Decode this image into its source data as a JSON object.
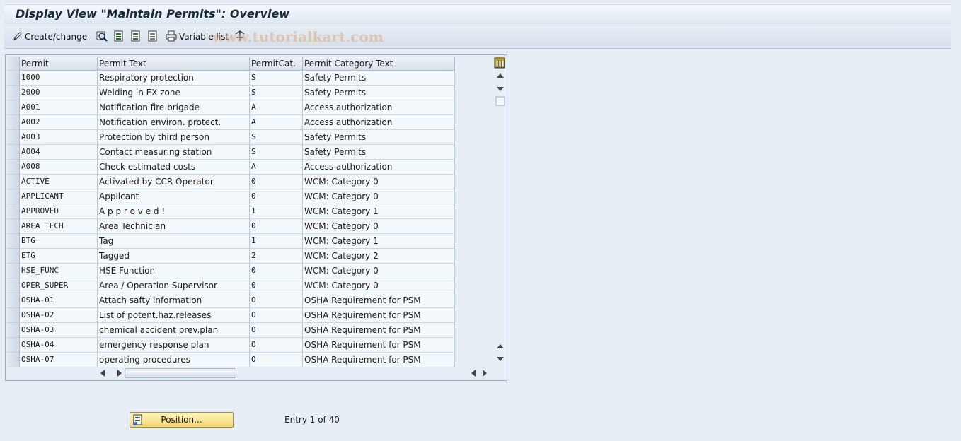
{
  "window": {
    "title": "Display View \"Maintain Permits\": Overview"
  },
  "toolbar": {
    "create_change_label": "Create/change",
    "variable_list_label": "Variable list",
    "watermark": "www.tutorialkart.com",
    "icons": [
      "pencil-icon",
      "search-icon",
      "select-all-icon",
      "select-block-icon",
      "deselect-all-icon",
      "printer-icon",
      "transport-icon"
    ]
  },
  "table": {
    "columns": [
      "Permit",
      "Permit Text",
      "PermitCat.",
      "Permit Category Text"
    ],
    "rows": [
      [
        "1000",
        "Respiratory protection",
        "S",
        "Safety Permits"
      ],
      [
        "2000",
        "Welding in EX zone",
        "S",
        "Safety Permits"
      ],
      [
        "A001",
        "Notification fire brigade",
        "A",
        "Access authorization"
      ],
      [
        "A002",
        "Notification environ. protect.",
        "A",
        "Access authorization"
      ],
      [
        "A003",
        "Protection by third person",
        "S",
        "Safety Permits"
      ],
      [
        "A004",
        "Contact measuring station",
        "S",
        "Safety Permits"
      ],
      [
        "A008",
        "Check estimated costs",
        "A",
        "Access authorization"
      ],
      [
        "ACTIVE",
        "Activated by CCR Operator",
        "0",
        "WCM: Category 0"
      ],
      [
        "APPLICANT",
        "Applicant",
        "0",
        "WCM: Category 0"
      ],
      [
        "APPROVED",
        "A p p r o v e d !",
        "1",
        "WCM: Category 1"
      ],
      [
        "AREA_TECH",
        "Area Technician",
        "0",
        "WCM: Category 0"
      ],
      [
        "BTG",
        "Tag",
        "1",
        "WCM: Category 1"
      ],
      [
        "ETG",
        "Tagged",
        "2",
        "WCM: Category 2"
      ],
      [
        "HSE_FUNC",
        "HSE Function",
        "0",
        "WCM: Category 0"
      ],
      [
        "OPER_SUPER",
        "Area / Operation Supervisor",
        "0",
        "WCM: Category 0"
      ],
      [
        "OSHA-01",
        "Attach safty information",
        "O",
        "OSHA Requirement for PSM"
      ],
      [
        "OSHA-02",
        "List of potent.haz.releases",
        "O",
        "OSHA Requirement for PSM"
      ],
      [
        "OSHA-03",
        "chemical accident prev.plan",
        "O",
        "OSHA Requirement for PSM"
      ],
      [
        "OSHA-04",
        "emergency response plan",
        "O",
        "OSHA Requirement for PSM"
      ],
      [
        "OSHA-07",
        "operating procedures",
        "O",
        "OSHA Requirement for PSM"
      ]
    ]
  },
  "footer": {
    "position_button_label": "Position...",
    "entry_text": "Entry 1 of 40"
  },
  "colors": {
    "background": "#e8eef6",
    "button_yellow": "#f3d776",
    "grid_border": "#9fb0c2"
  }
}
